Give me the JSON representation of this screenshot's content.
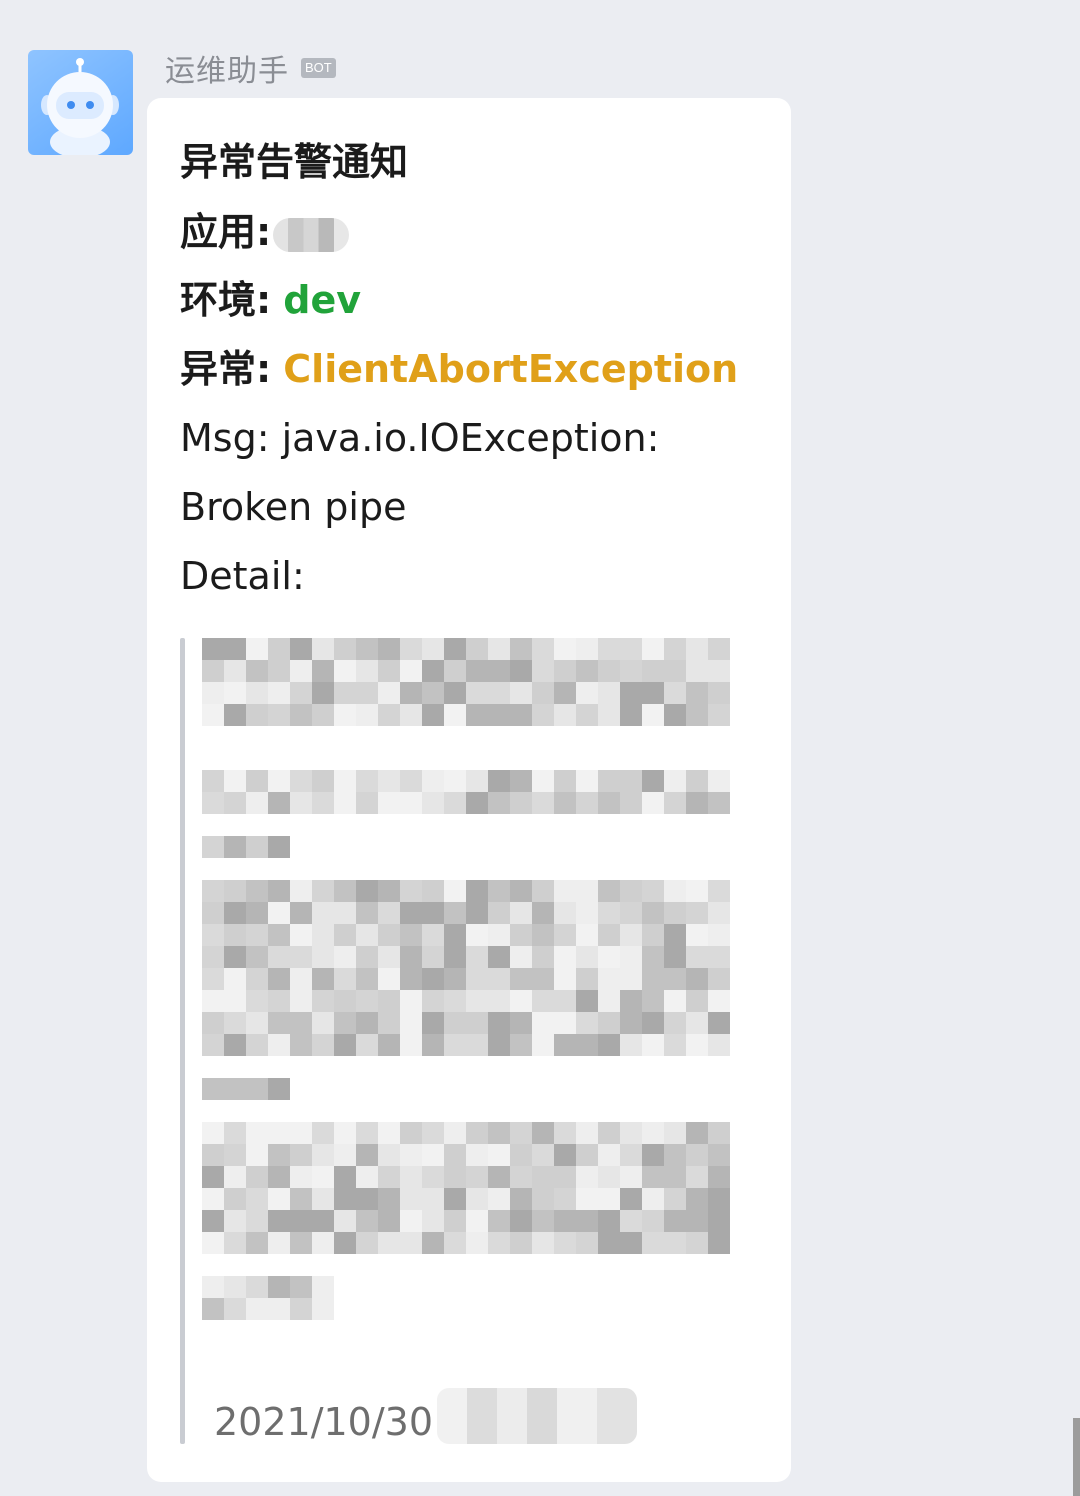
{
  "sender": {
    "name": "运维助手",
    "badge": "BOT"
  },
  "message": {
    "title": "异常告警通知",
    "app_label": "应用:",
    "env_label": "环境:",
    "env_value": "dev",
    "exception_label": "异常:",
    "exception_value": "ClientAbortException",
    "msg_line1": "Msg: java.io.IOException:",
    "msg_line2": "Broken pipe",
    "detail_label": "Detail:",
    "timestamp": "2021/10/30"
  },
  "colors": {
    "background": "#ebedf2",
    "bubble": "#ffffff",
    "env_value": "#21a33a",
    "exception_value": "#e0a019",
    "avatar": "#6aafff"
  },
  "icons": {
    "avatar": "robot-icon"
  }
}
